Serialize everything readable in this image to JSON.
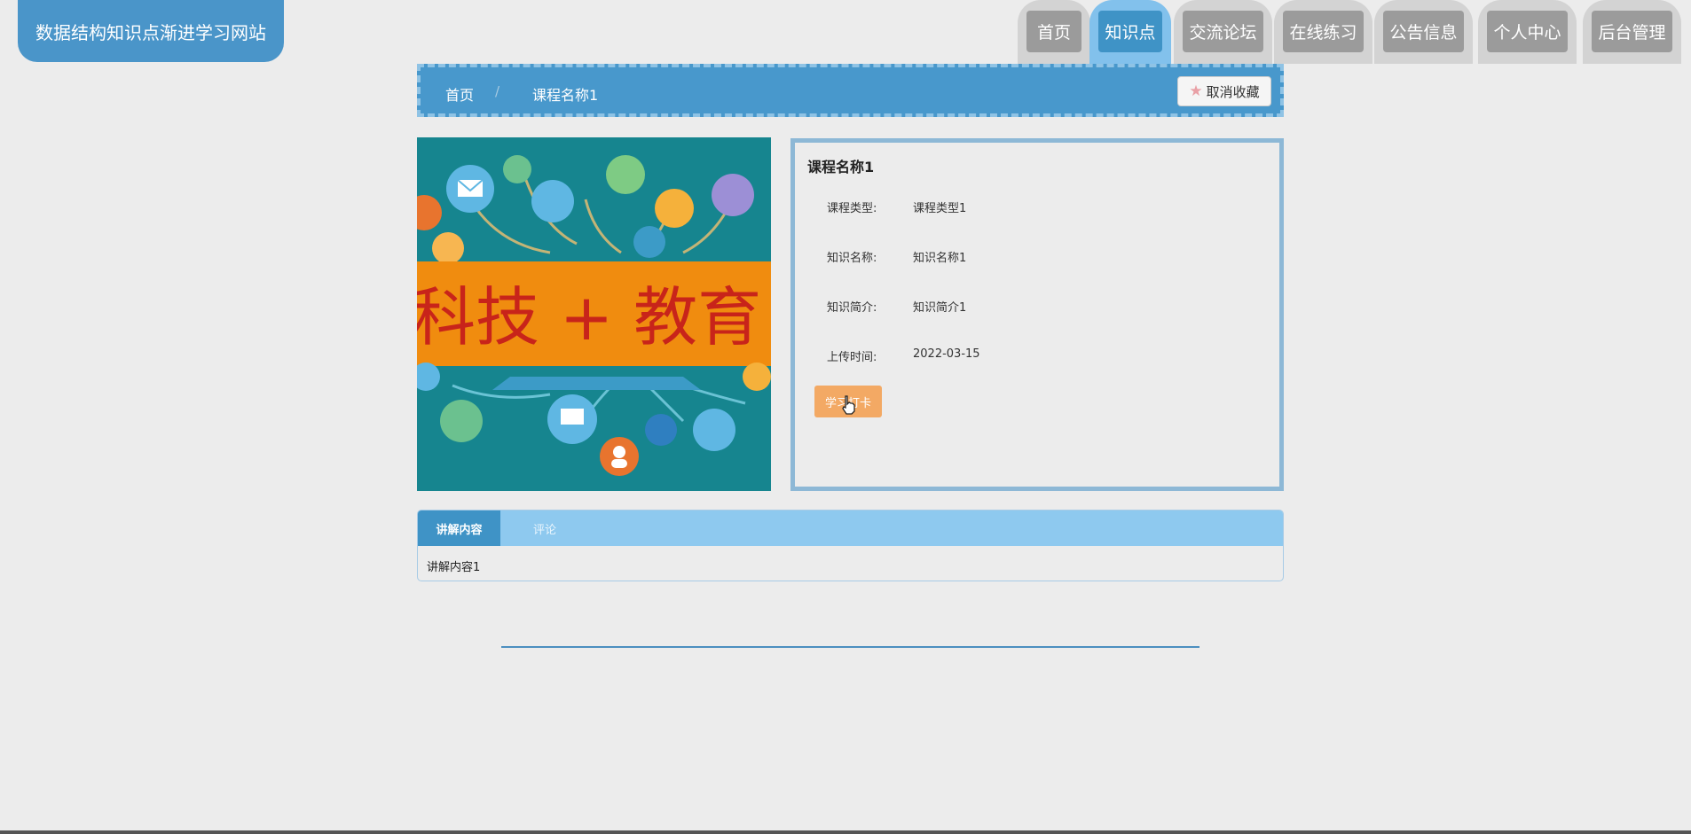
{
  "site": {
    "title": "数据结构知识点渐进学习网站"
  },
  "nav": {
    "items": [
      {
        "label": "首页",
        "active": false
      },
      {
        "label": "知识点",
        "active": true
      },
      {
        "label": "交流论坛",
        "active": false
      },
      {
        "label": "在线练习",
        "active": false
      },
      {
        "label": "公告信息",
        "active": false
      },
      {
        "label": "个人中心",
        "active": false
      },
      {
        "label": "后台管理",
        "active": false
      }
    ]
  },
  "breadcrumb": {
    "home": "首页",
    "separator": "/",
    "current": "课程名称1",
    "favorite_button": "取消收藏"
  },
  "course_image": {
    "banner_text": "科技 + 教育"
  },
  "course": {
    "title": "课程名称1",
    "fields": [
      {
        "label": "课程类型:",
        "value": "课程类型1"
      },
      {
        "label": "知识名称:",
        "value": "知识名称1"
      },
      {
        "label": "知识简介:",
        "value": "知识简介1"
      },
      {
        "label": "上传时间:",
        "value": "2022-03-15"
      }
    ],
    "study_button": "学习打卡"
  },
  "tabs": {
    "items": [
      {
        "label": "讲解内容",
        "active": true
      },
      {
        "label": "评论",
        "active": false
      }
    ],
    "content": "讲解内容1"
  },
  "colors": {
    "primary": "#4a95c9",
    "nav_active": "#3f93c6",
    "nav_inactive": "#9b9b9b",
    "study_button": "#f3a964",
    "banner": "#f08c0f",
    "banner_text": "#c8241a"
  }
}
